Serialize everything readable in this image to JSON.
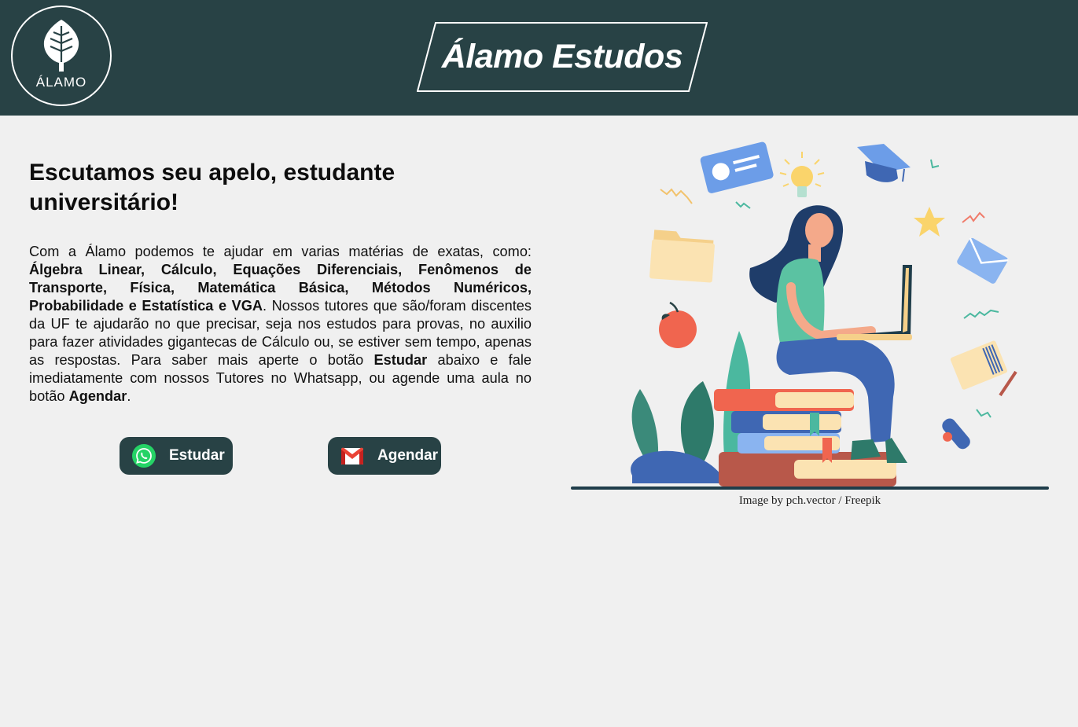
{
  "header": {
    "logo_text": "ÁLAMO",
    "brand_title": "Álamo Estudos"
  },
  "hero": {
    "heading": "Escutamos seu apelo, estudante universitário!",
    "paragraph": {
      "intro": "Com a Álamo podemos te ajudar em varias matérias de exatas, como: ",
      "subjects": "Álgebra Linear, Cálculo, Equações Diferenciais, Fenômenos de Transporte, Física, Matemática Básica, Métodos Numéricos, Probabilidade e Estatística e VGA",
      "middle": ". Nossos tutores que são/foram discentes da UF te ajudarão no que precisar, seja nos estudos para provas, no auxilio para fazer atividades gigantecas de Cálculo ou, se estiver sem tempo, apenas as respostas. Para saber mais aperte o botão ",
      "estudar_word": "Estudar",
      "middle2": " abaixo e fale imediatamente com nossos Tutores no Whatsapp, ou agende uma aula no botão ",
      "agendar_word": "Agendar",
      "end": "."
    }
  },
  "buttons": {
    "estudar": {
      "label": "Estudar",
      "icon": "whatsapp-icon"
    },
    "agendar": {
      "label": "Agendar",
      "icon": "gmail-icon"
    }
  },
  "illustration": {
    "credit": "Image by pch.vector / Freepik"
  },
  "colors": {
    "header_bg": "#284245",
    "page_bg": "#f0f0f0",
    "button_bg": "#284245",
    "whatsapp_green": "#25d366",
    "gmail_red": "#ea4335"
  }
}
